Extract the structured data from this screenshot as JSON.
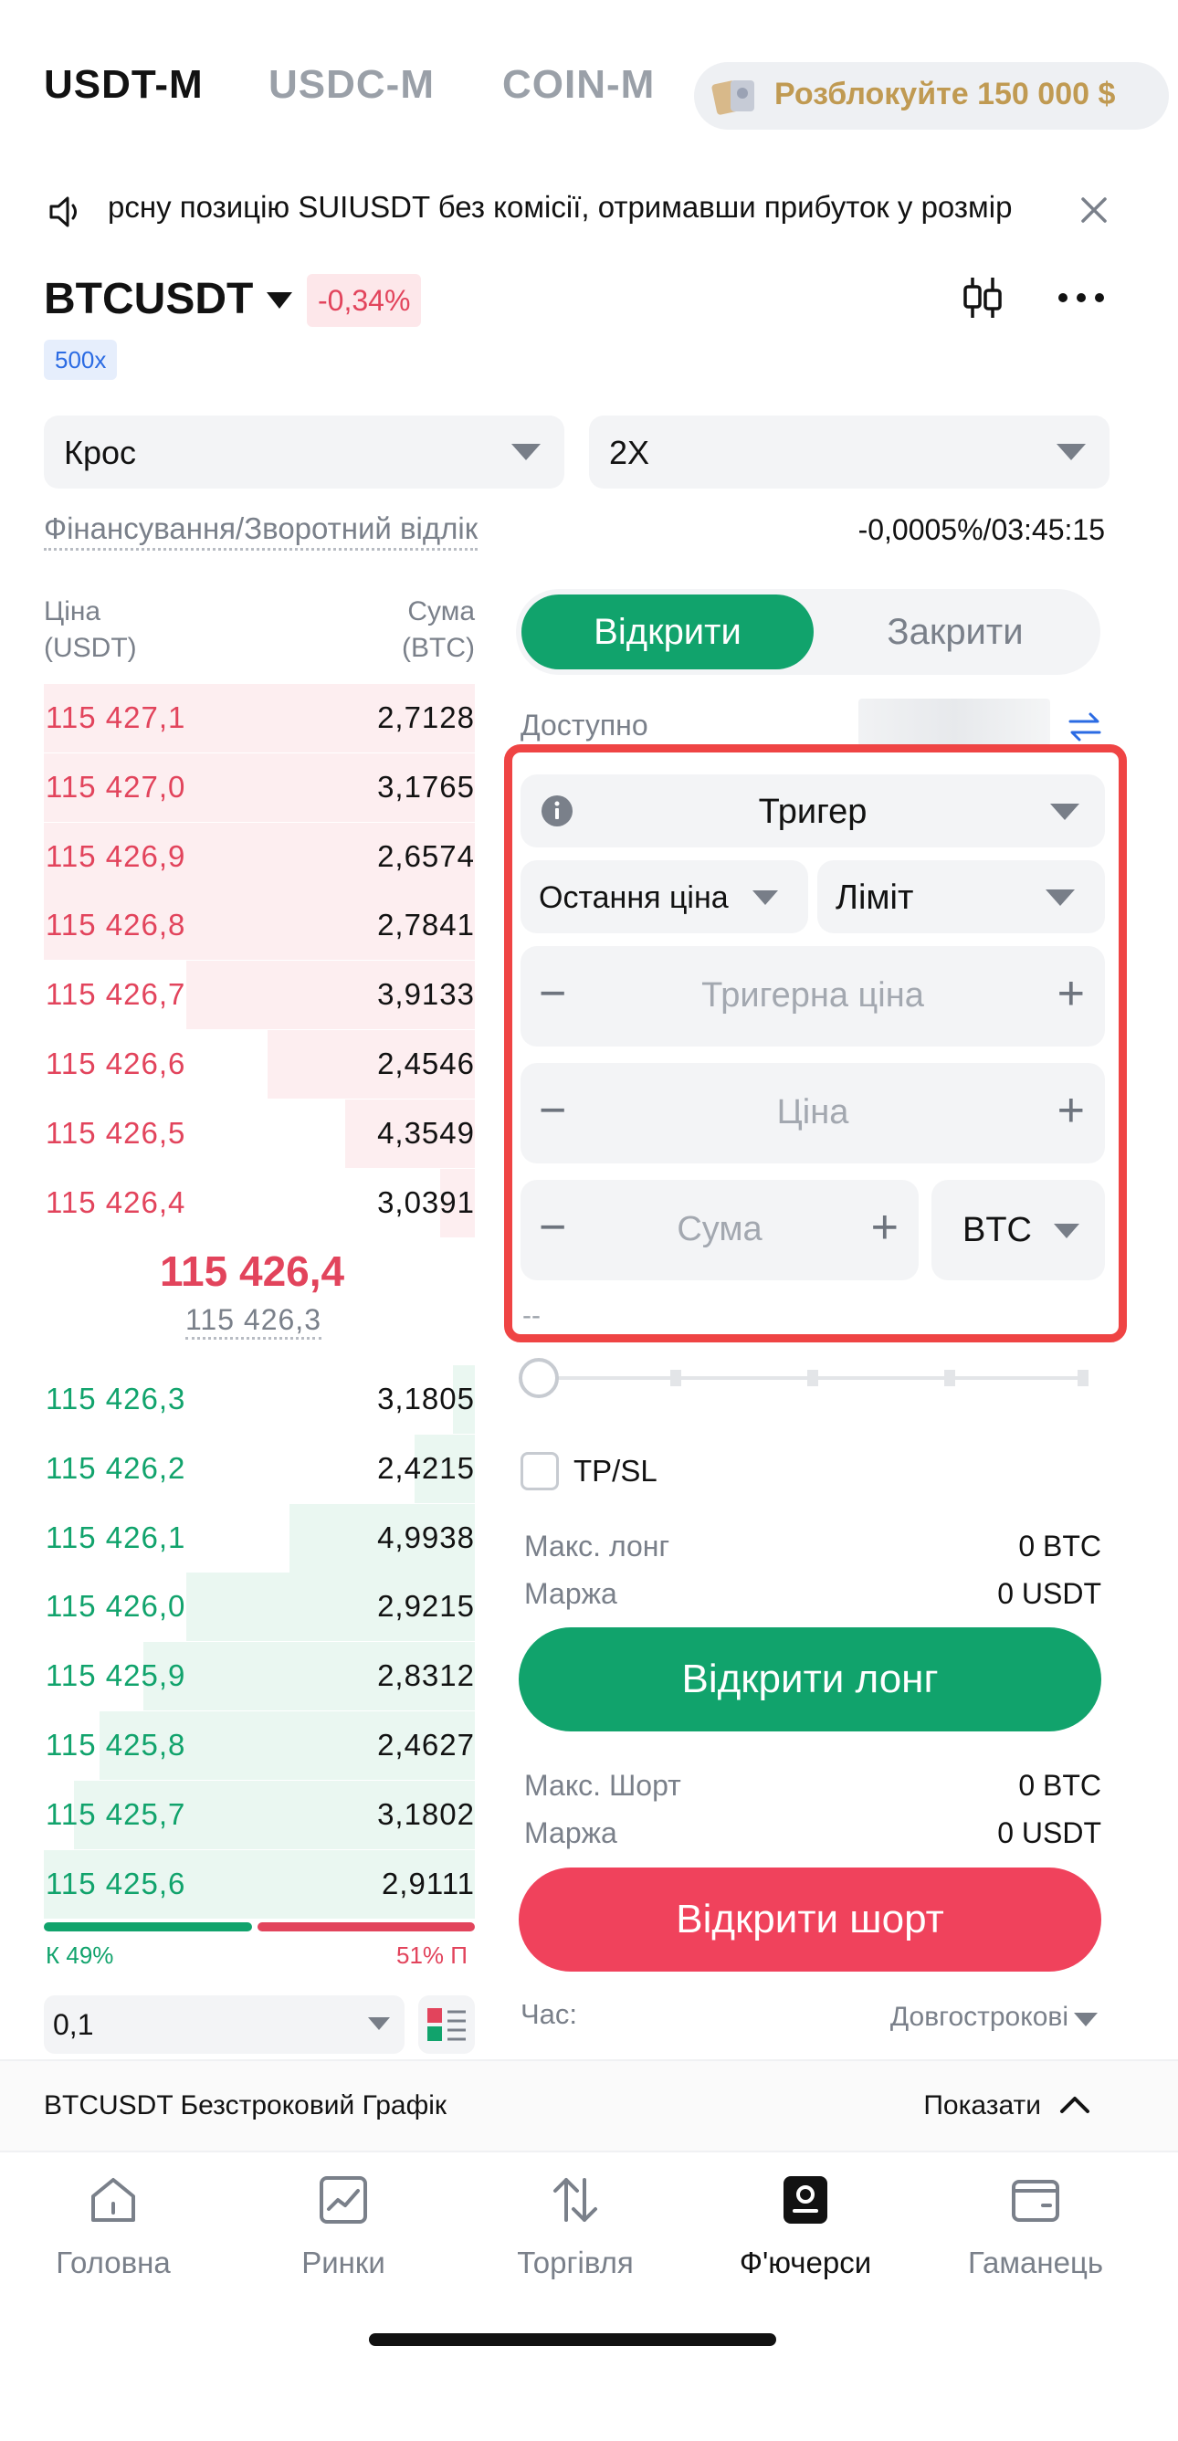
{
  "top_tabs": [
    "USDT-M",
    "USDC-M",
    "COIN-M"
  ],
  "promo": {
    "text": "Розблокуйте 150 000 $"
  },
  "announcement": {
    "text": "рсну позицію SUIUSDT без комісії, отримавши прибуток у розмір"
  },
  "symbol": {
    "name": "BTCUSDT",
    "change": "-0,34%",
    "leverage_badge": "500x"
  },
  "margin_mode": "Крос",
  "leverage": "2X",
  "funding": {
    "label": "Фінансування/Зворотний відлік",
    "value": "-0,0005%/03:45:15"
  },
  "order_book": {
    "price_header": "Ціна",
    "price_unit": "(USDT)",
    "amount_header": "Сума",
    "amount_unit": "(BTC)",
    "asks": [
      {
        "price": "115 427,1",
        "amount": "2,7128",
        "depth": 1.0
      },
      {
        "price": "115 427,0",
        "amount": "3,1765",
        "depth": 1.0
      },
      {
        "price": "115 426,9",
        "amount": "2,6574",
        "depth": 1.0
      },
      {
        "price": "115 426,8",
        "amount": "2,7841",
        "depth": 1.0
      },
      {
        "price": "115 426,7",
        "amount": "3,9133",
        "depth": 0.67
      },
      {
        "price": "115 426,6",
        "amount": "2,4546",
        "depth": 0.48
      },
      {
        "price": "115 426,5",
        "amount": "4,3549",
        "depth": 0.3
      },
      {
        "price": "115 426,4",
        "amount": "3,0391",
        "depth": 0.08
      }
    ],
    "mid_price": "115 426,4",
    "mark_price": "115 426,3",
    "bids": [
      {
        "price": "115 426,3",
        "amount": "3,1805",
        "depth": 0.05
      },
      {
        "price": "115 426,2",
        "amount": "2,4215",
        "depth": 0.14
      },
      {
        "price": "115 426,1",
        "amount": "4,9938",
        "depth": 0.43
      },
      {
        "price": "115 426,0",
        "amount": "2,9215",
        "depth": 0.67
      },
      {
        "price": "115 425,9",
        "amount": "2,8312",
        "depth": 0.77
      },
      {
        "price": "115 425,8",
        "amount": "2,4627",
        "depth": 0.87
      },
      {
        "price": "115 425,7",
        "amount": "3,1802",
        "depth": 0.93
      },
      {
        "price": "115 425,6",
        "amount": "2,9111",
        "depth": 1.0
      }
    ],
    "long_ratio": "К 49%",
    "short_ratio": "51% П",
    "long_fraction": 0.49,
    "precision": "0,1"
  },
  "order_form": {
    "open_tab": "Відкрити",
    "close_tab": "Закрити",
    "available_label": "Доступно",
    "order_type": "Тригер",
    "trigger_source": "Остання ціна",
    "exec_type": "Ліміт",
    "trigger_price_placeholder": "Тригерна ціна",
    "price_placeholder": "Ціна",
    "amount_placeholder": "Сума",
    "amount_unit": "BTC",
    "cost_placeholder": "--",
    "tpsl_label": "TP/SL",
    "max_long_label": "Макс. лонг",
    "max_long_value": "0 BTC",
    "margin_label": "Маржа",
    "margin_long_value": "0 USDT",
    "open_long_button": "Відкрити лонг",
    "max_short_label": "Макс. Шорт",
    "max_short_value": "0 BTC",
    "margin_short_value": "0 USDT",
    "open_short_button": "Відкрити шорт",
    "time_label": "Час:",
    "time_value": "Довгострокові"
  },
  "chart_bar": {
    "label": "BTCUSDT Безстроковий Графік",
    "toggle": "Показати"
  },
  "bottom_nav": [
    "Головна",
    "Ринки",
    "Торгівля",
    "Ф'ючерси",
    "Гаманець"
  ],
  "colors": {
    "green": "#11a36c",
    "red": "#e2445c",
    "highlight": "#ef4444",
    "gold": "#c09a52"
  }
}
